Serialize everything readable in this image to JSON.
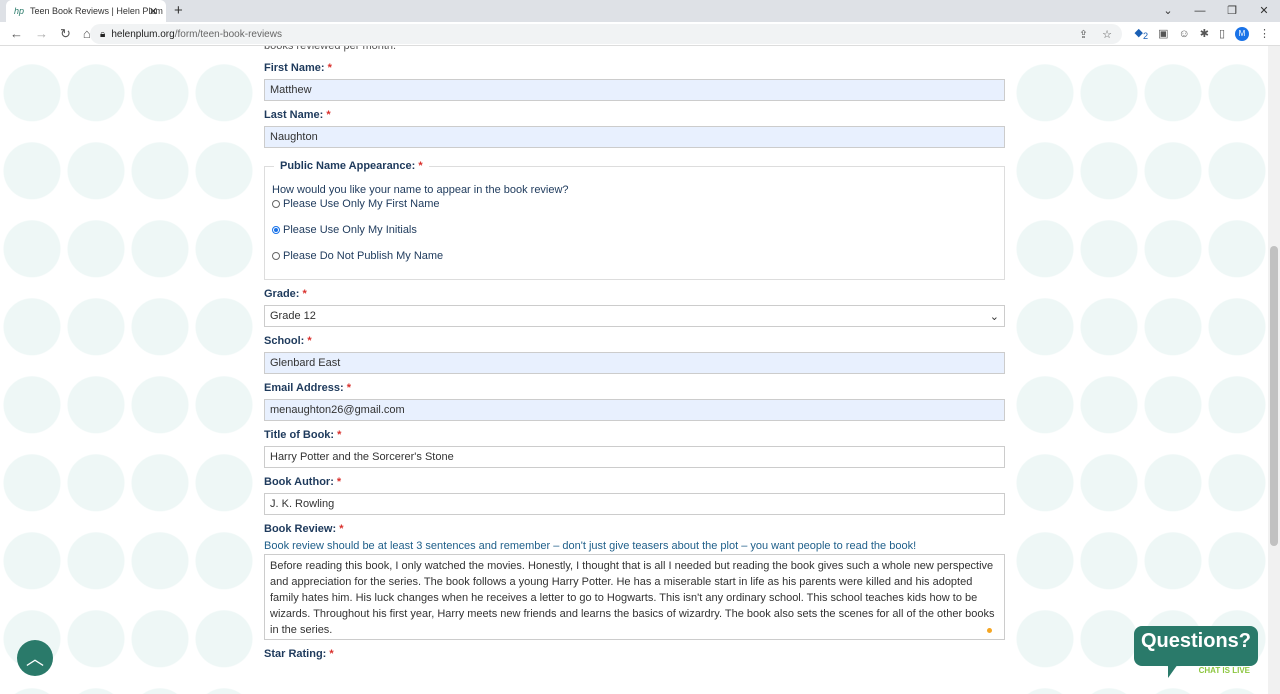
{
  "browser": {
    "tab_title": "Teen Book Reviews | Helen Plum",
    "url_domain": "helenplum.org",
    "url_path": "/form/teen-book-reviews",
    "avatar": "M",
    "ext_badge": "2"
  },
  "form": {
    "top_cut": "books reviewed per month.",
    "first_name": {
      "label": "First Name:",
      "value": "Matthew"
    },
    "last_name": {
      "label": "Last Name:",
      "value": "Naughton"
    },
    "public_name": {
      "legend": "Public Name Appearance:",
      "question": "How would you like your name to appear in the book review?",
      "options": [
        "Please Use Only My First Name",
        "Please Use Only My Initials",
        "Please Do Not Publish My Name"
      ],
      "selected": 1
    },
    "grade": {
      "label": "Grade:",
      "value": "Grade 12"
    },
    "school": {
      "label": "School:",
      "value": "Glenbard East"
    },
    "email": {
      "label": "Email Address:",
      "value": "menaughton26@gmail.com"
    },
    "title": {
      "label": "Title of Book:",
      "value": "Harry Potter and the Sorcerer's Stone"
    },
    "author": {
      "label": "Book Author:",
      "value": "J. K. Rowling"
    },
    "review": {
      "label": "Book Review:",
      "help": "Book review should be at least 3 sentences and remember – don't just give teasers about the plot – you want people to read the book!",
      "value": "Before reading this book, I only watched the movies.  Honestly, I thought that is all I needed but reading the book gives such a whole new perspective and appreciation for the series.  The book follows a young Harry Potter.  He has a miserable start in life as his parents were killed and his adopted family hates him.  His luck changes when he receives a letter to go to Hogwarts.  This isn't any ordinary school.  This school teaches kids how to be wizards.  Throughout his first year, Harry meets new friends and learns the basics of wizardry. The book also sets the scenes for all of the other books in the series."
    },
    "star_rating": {
      "label": "Star Rating:"
    },
    "required_mark": "*"
  },
  "chat": {
    "title": "Questions?",
    "subtitle": "CHAT IS LIVE"
  }
}
